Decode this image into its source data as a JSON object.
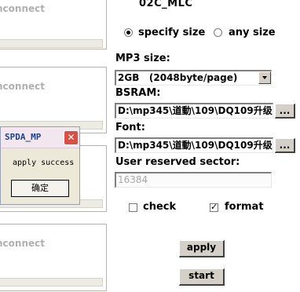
{
  "device_panels": [
    {
      "label": "nconnect"
    },
    {
      "label": "nconnect"
    },
    {
      "label": "nconnect"
    },
    {
      "label": "nconnect"
    }
  ],
  "flash_type": "02C_MLC",
  "size_mode": {
    "specify_label": "specify size",
    "any_label": "any size",
    "selected": "specify"
  },
  "mp3_size": {
    "label": "MP3 size:",
    "selected": "2GB   (2048byte/page)"
  },
  "bsram": {
    "label": "BSRAM:",
    "value": "D:\\mp345\\道動\\109\\DQ109升级",
    "browse_label": "..."
  },
  "font": {
    "label": "Font:",
    "value": "D:\\mp345\\道動\\109\\DQ109升级",
    "browse_label": "..."
  },
  "user_reserved": {
    "label": "User reserved sector:",
    "value": "16384"
  },
  "options": {
    "check_label": "check",
    "check_checked": false,
    "format_label": "format",
    "format_checked": true
  },
  "buttons": {
    "apply": "apply",
    "start": "start"
  },
  "dialog": {
    "title": "SPDA_MP",
    "message": "apply success",
    "ok_label": "确定",
    "close_glyph": "✕"
  }
}
